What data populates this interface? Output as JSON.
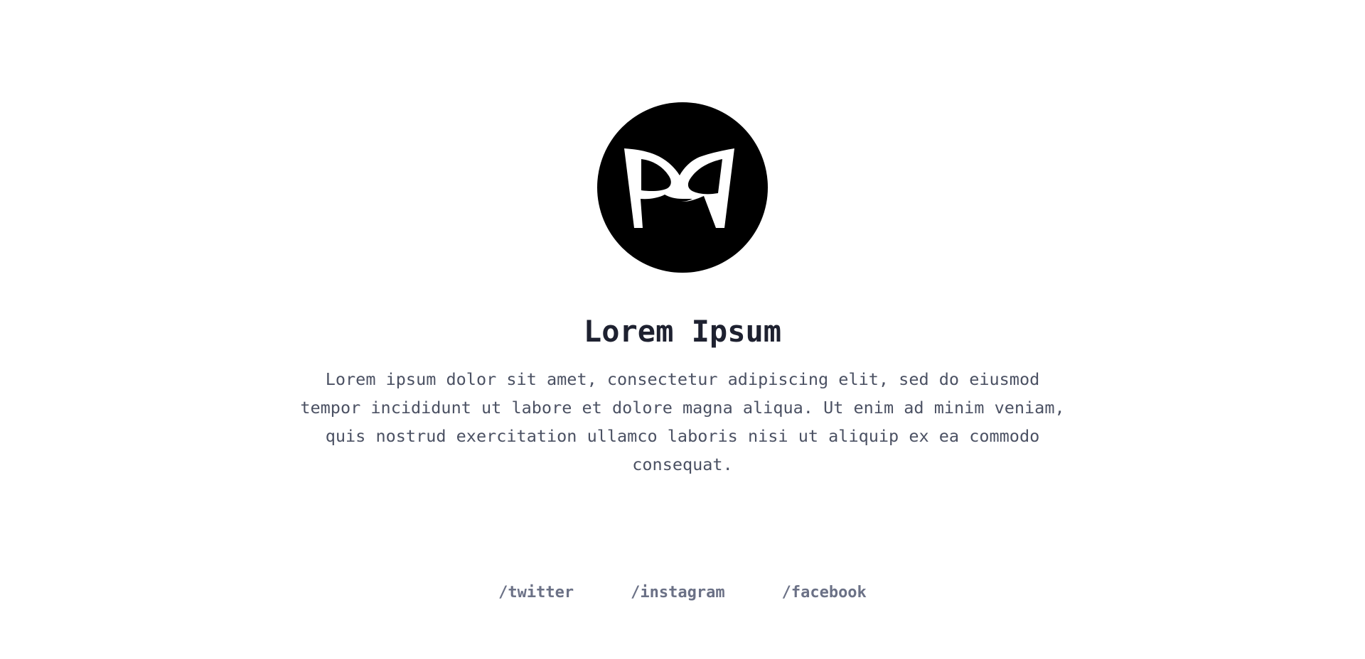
{
  "logo": {
    "icon": "mask-monogram-icon",
    "background_color": "#000000",
    "glyph_color": "#ffffff"
  },
  "hero": {
    "title": "Lorem Ipsum",
    "description": "Lorem ipsum dolor sit amet, consectetur adipiscing elit, sed do eiusmod tempor incididunt ut labore et dolore magna aliqua. Ut enim ad minim veniam, quis nostrud exercitation ullamco laboris nisi ut aliquip ex ea commodo consequat."
  },
  "social": {
    "links": [
      {
        "label": "/twitter"
      },
      {
        "label": "/instagram"
      },
      {
        "label": "/facebook"
      }
    ]
  },
  "colors": {
    "title": "#1e2130",
    "body_text": "#4b5163",
    "link": "#6b7186"
  }
}
